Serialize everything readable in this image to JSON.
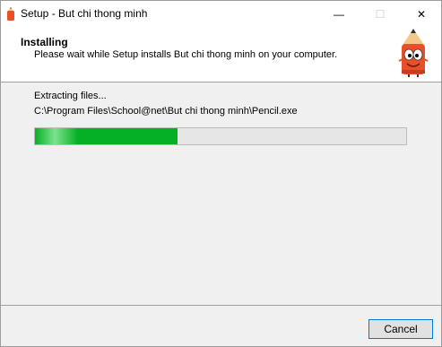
{
  "window": {
    "title": "Setup - But chi thong minh",
    "minimize": "—",
    "maximize": "☐",
    "close": "✕"
  },
  "header": {
    "title": "Installing",
    "subtitle": "Please wait while Setup installs But chi thong minh on your computer."
  },
  "main": {
    "status": "Extracting files...",
    "current_file": "C:\\Program Files\\School@net\\But chi thong minh\\Pencil.exe",
    "progress": 0.385
  },
  "footer": {
    "cancel_label": "Cancel"
  },
  "colors": {
    "progress_fill": "#06b025",
    "focus_border": "#0078d7",
    "mascot_body": "#e8502a",
    "pencil_tip": "#f4c88c"
  },
  "icons": {
    "app": "pencil-app-icon",
    "mascot": "pencil-mascot-icon"
  }
}
